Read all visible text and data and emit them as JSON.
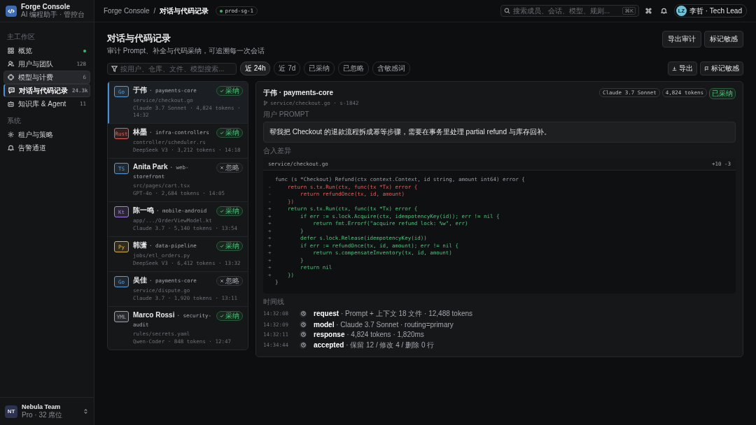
{
  "brand": {
    "title": "Forge Console",
    "subtitle": "AI 编程助手 · 管控台"
  },
  "sidebar": {
    "groups": [
      {
        "label": "主工作区",
        "items": [
          {
            "label": "概览",
            "dot": true,
            "selected": false,
            "hovered": false
          },
          {
            "label": "用户与团队",
            "count": "128",
            "dot": false,
            "selected": false,
            "hovered": false
          },
          {
            "label": "模型与计费",
            "count": "6",
            "dot": false,
            "selected": false,
            "hovered": true
          },
          {
            "label": "对话与代码记录",
            "count": "24.3k",
            "dot": false,
            "selected": true,
            "hovered": false
          },
          {
            "label": "知识库 & Agent",
            "count": "11",
            "dot": false,
            "selected": false,
            "hovered": false
          }
        ]
      },
      {
        "label": "系统",
        "items": [
          {
            "label": "租户与策略",
            "dot": false,
            "selected": false,
            "hovered": false
          },
          {
            "label": "告警通道",
            "dot": false,
            "selected": false,
            "hovered": false
          }
        ]
      }
    ]
  },
  "team": {
    "initials": "NT",
    "name": "Nebula Team",
    "plan": "Pro · 32 席位"
  },
  "topbar": {
    "breadcrumb": [
      "Forge Console",
      "/",
      "对话与代码记录"
    ],
    "env": "prod-sg-1",
    "search_placeholder": "搜索成员、会话、模型、规则...",
    "shortcut": "⌘K",
    "user_initials": "LZ",
    "user": "李哲 · Tech Lead"
  },
  "page": {
    "title": "对话与代码记录",
    "subtitle": "审计 Prompt、补全与代码采纳，可追溯每一次会话",
    "actions": [
      "导出审计",
      "标记敏感"
    ]
  },
  "filters": {
    "placeholder": "按用户、仓库、文件、模型搜索...",
    "chips": [
      {
        "label": "近 24h",
        "selected": true
      },
      {
        "label": "近 7d",
        "selected": false
      },
      {
        "label": "已采纳",
        "selected": false
      },
      {
        "label": "已忽略",
        "selected": false
      },
      {
        "label": "含敏感词",
        "selected": false
      }
    ],
    "tools": [
      "导出",
      "标记敏感"
    ]
  },
  "sessions": [
    {
      "lang": "Go",
      "color": "#5b9bd5",
      "user": "于伟",
      "repo": "· payments-core",
      "path": "service/checkout.go",
      "meta": "Claude 3.7 Sonnet · 4,824 tokens · 14:32",
      "kind": "accepted",
      "status_label": "采纳",
      "selected": true
    },
    {
      "lang": "Rust",
      "color": "#e0605a",
      "user": "林墨",
      "repo": "· infra-controllers",
      "path": "controller/scheduler.rs",
      "meta": "DeepSeek V3 · 3,212 tokens · 14:18",
      "kind": "accepted",
      "status_label": "采纳",
      "selected": false
    },
    {
      "lang": "TS",
      "color": "#5b9bd5",
      "user": "Anita Park",
      "repo": "· web-storefront",
      "path": "src/pages/cart.tsx",
      "meta": "GPT-4o · 2,684 tokens · 14:05",
      "kind": "ignored",
      "status_label": "忽略",
      "selected": false
    },
    {
      "lang": "Kt",
      "color": "#a67ee0",
      "user": "陈一鸣",
      "repo": "· mobile-android",
      "path": "app/.../OrderViewModel.kt",
      "meta": "Claude 3.7 · 5,140 tokens · 13:54",
      "kind": "accepted",
      "status_label": "采纳",
      "selected": false
    },
    {
      "lang": "Py",
      "color": "#d9b341",
      "user": "韩潇",
      "repo": "· data-pipeline",
      "path": "jobs/etl_orders.py",
      "meta": "DeepSeek V3 · 6,412 tokens · 13:32",
      "kind": "accepted",
      "status_label": "采纳",
      "selected": false
    },
    {
      "lang": "Go",
      "color": "#5b9bd5",
      "user": "吴佳",
      "repo": "· payments-core",
      "path": "service/dispute.go",
      "meta": "Claude 3.7 · 1,920 tokens · 13:11",
      "kind": "ignored",
      "status_label": "忽略",
      "selected": false
    },
    {
      "lang": "YML",
      "color": "#a0a4ab",
      "user": "Marco Rossi",
      "repo": "· security-audit",
      "path": "rules/secrets.yaml",
      "meta": "Qwen-Coder · 848 tokens · 12:47",
      "kind": "accepted",
      "status_label": "采纳",
      "selected": false
    }
  ],
  "detail": {
    "title": "于伟 · payments-core",
    "path": "service/checkout.go · s-1842",
    "tags": [
      {
        "label": "Claude 3.7 Sonnet",
        "kind": "plain"
      },
      {
        "label": "4,824 tokens",
        "kind": "plain"
      },
      {
        "label": "已采纳",
        "kind": "accepted"
      }
    ],
    "prompt_label": "用户 PROMPT",
    "prompt": "帮我把 Checkout 的退款流程拆成幂等步骤，需要在事务里处理 partial refund 与库存回补。",
    "diff_label": "合入差异",
    "diff_file": "service/checkout.go",
    "diff_stat": "+10 -3",
    "code": [
      {
        "kind": "context",
        "text": "func (s *Checkout) Refund(ctx context.Context, id string, amount int64) error {"
      },
      {
        "kind": "del",
        "sign": "-",
        "text": "    return s.tx.Run(ctx, func(tx *Tx) error {"
      },
      {
        "kind": "del",
        "sign": "-",
        "text": "        return refundOnce(tx, id, amount)"
      },
      {
        "kind": "del",
        "sign": "-",
        "text": "    })"
      },
      {
        "kind": "add",
        "sign": "+",
        "text": "    return s.tx.Run(ctx, func(tx *Tx) error {"
      },
      {
        "kind": "add",
        "sign": "+",
        "text": "        if err := s.lock.Acquire(ctx, idempotencyKey(id)); err != nil {"
      },
      {
        "kind": "add",
        "sign": "+",
        "text": "            return fmt.Errorf(\"acquire refund lock: %w\", err)"
      },
      {
        "kind": "add",
        "sign": "+",
        "text": "        }"
      },
      {
        "kind": "add",
        "sign": "+",
        "text": "        defer s.lock.Release(idempotencyKey(id))"
      },
      {
        "kind": "add",
        "sign": "+",
        "text": "        if err := refundOnce(tx, id, amount); err != nil {"
      },
      {
        "kind": "add",
        "sign": "+",
        "text": "            return s.compensateInventory(tx, id, amount)"
      },
      {
        "kind": "add",
        "sign": "+",
        "text": "        }"
      },
      {
        "kind": "add",
        "sign": "+",
        "text": "        return nil"
      },
      {
        "kind": "add",
        "sign": "+",
        "text": "    })"
      },
      {
        "kind": "context",
        "text": "}"
      }
    ],
    "timeline_label": "时间线",
    "timeline": [
      {
        "time": "14:32:08",
        "event": "request",
        "detail": " · Prompt + 上下文 18 文件 · 12,488 tokens"
      },
      {
        "time": "14:32:09",
        "event": "model",
        "detail": " · Claude 3.7 Sonnet · routing=primary"
      },
      {
        "time": "14:32:11",
        "event": "response",
        "detail": " · 4,824 tokens · 1,820ms"
      },
      {
        "time": "14:34:44",
        "event": "accepted",
        "detail": " · 保留 12 / 修改 4 / 删除 0 行"
      }
    ]
  }
}
